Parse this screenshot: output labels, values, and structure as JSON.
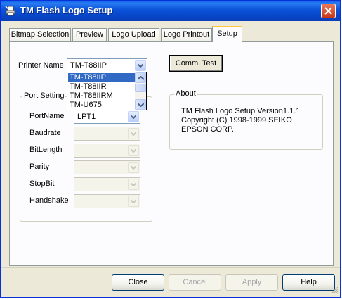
{
  "window": {
    "title": "TM Flash Logo Setup",
    "icon": "app-printer-icon",
    "titlebar_color": "#0a52d8"
  },
  "tabs": [
    {
      "label": "Bitmap Selection"
    },
    {
      "label": "Preview"
    },
    {
      "label": "Logo Upload"
    },
    {
      "label": "Logo Printout"
    },
    {
      "label": "Setup",
      "active": true
    }
  ],
  "setup": {
    "printer_name_label": "Printer Name",
    "printer_name_value": "TM-T88IIP",
    "printer_options": [
      "TM-T88IIP",
      "TM-T88IIR",
      "TM-T88IIRM",
      "TM-U675"
    ],
    "comm_test_label": "Comm. Test",
    "port_setting": {
      "title": "Port Setting",
      "port_name_label": "PortName",
      "port_name_value": "LPT1",
      "baudrate_label": "Baudrate",
      "bitlength_label": "BitLength",
      "parity_label": "Parity",
      "stopbit_label": "StopBit",
      "handshake_label": "Handshake"
    },
    "about": {
      "title": "About",
      "line1": "TM Flash Logo Setup Version1.1.1",
      "line2": "Copyright (C) 1998-1999 SEIKO",
      "line3": "EPSON CORP."
    }
  },
  "footer": {
    "close_label": "Close",
    "cancel_label": "Cancel",
    "apply_label": "Apply",
    "help_label": "Help"
  },
  "colors": {
    "selection": "#316ac5",
    "dialog_bg": "#ece9d8",
    "active_tab_accent": "#ffc83c"
  }
}
